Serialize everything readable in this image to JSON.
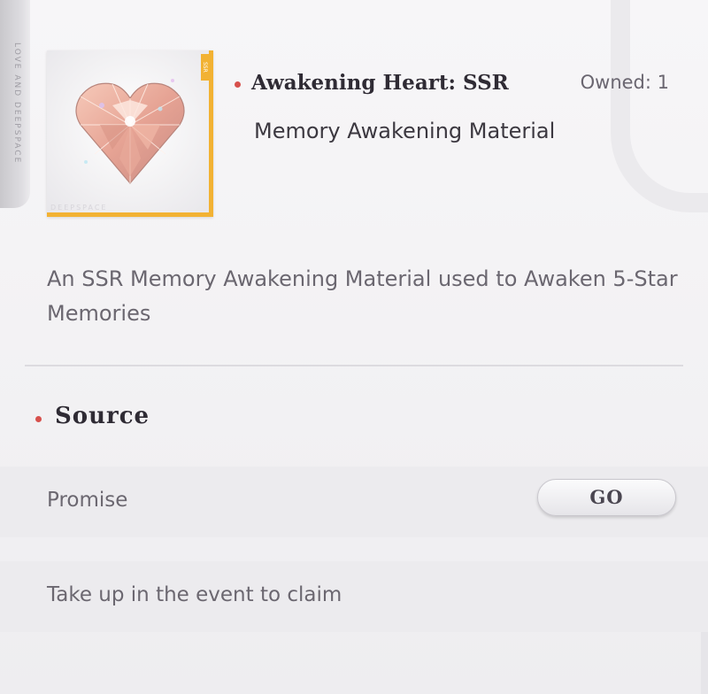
{
  "item": {
    "name": "Awakening Heart: SSR",
    "owned": "Owned: 1",
    "type": "Memory Awakening Material",
    "rarity_tag": "SSR",
    "card_watermark": "DEEPSPACE",
    "icon": "diamond-heart-icon",
    "description": "An SSR Memory Awakening Material used to Awaken 5-Star Memories"
  },
  "side_strip": {
    "text": "LOVE AND DEEPSPACE"
  },
  "source": {
    "heading": "Source",
    "rows": [
      {
        "label": "Promise",
        "button": "GO"
      },
      {
        "label": "Take up in the event to claim"
      }
    ]
  },
  "colors": {
    "accent_dot": "#d7504c",
    "rarity_gold": "#f2b233",
    "background": "#f3f2f4"
  }
}
